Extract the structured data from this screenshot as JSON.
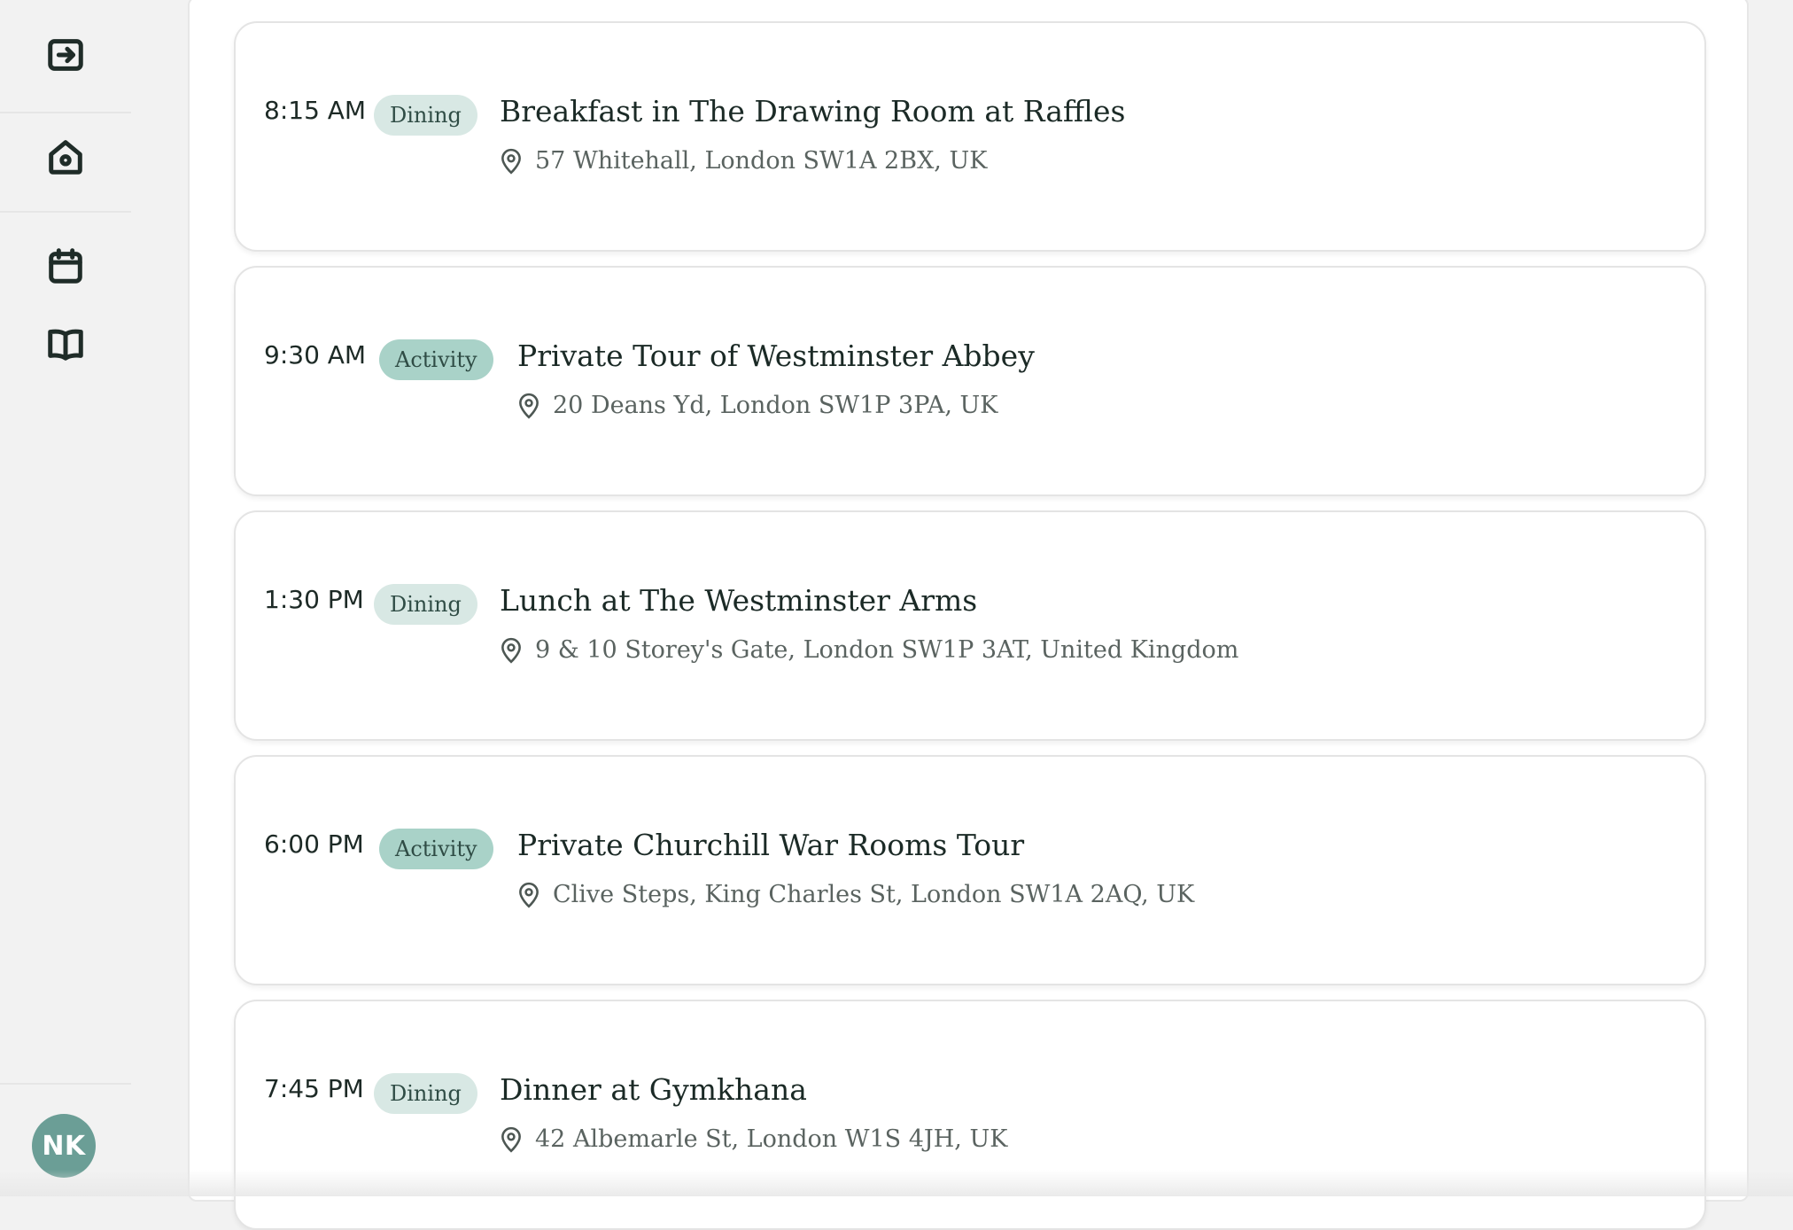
{
  "sidebar": {
    "icons": [
      "exit-icon",
      "home-icon",
      "calendar-icon",
      "book-icon"
    ],
    "avatar_initials": "NK",
    "avatar_color": "#6b9e96"
  },
  "colors": {
    "dining_badge": "#d8e8e4",
    "activity_badge": "#a9d2c8"
  },
  "itinerary": [
    {
      "time": "8:15 AM",
      "category": "Dining",
      "title": "Breakfast in The Drawing Room at Raffles",
      "address": "57 Whitehall, London SW1A 2BX, UK"
    },
    {
      "time": "9:30 AM",
      "category": "Activity",
      "title": "Private Tour of Westminster Abbey",
      "address": "20 Deans Yd, London SW1P 3PA, UK"
    },
    {
      "time": "1:30 PM",
      "category": "Dining",
      "title": "Lunch at The Westminster Arms",
      "address": "9 & 10 Storey's Gate, London SW1P 3AT, United Kingdom"
    },
    {
      "time": "6:00 PM",
      "category": "Activity",
      "title": "Private Churchill War Rooms Tour",
      "address": "Clive Steps, King Charles St, London SW1A 2AQ, UK"
    },
    {
      "time": "7:45 PM",
      "category": "Dining",
      "title": "Dinner at Gymkhana",
      "address": "42 Albemarle St, London W1S 4JH, UK"
    }
  ]
}
